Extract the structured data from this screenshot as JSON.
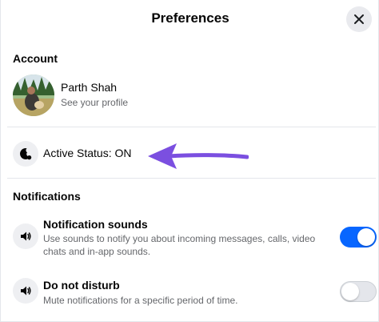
{
  "header": {
    "title": "Preferences"
  },
  "account": {
    "section_title": "Account",
    "profile_name": "Parth Shah",
    "profile_link": "See your profile"
  },
  "active_status": {
    "label": "Active Status: ON"
  },
  "notifications": {
    "section_title": "Notifications",
    "items": [
      {
        "title": "Notification sounds",
        "description": "Use sounds to notify you about incoming messages, calls, video chats and in-app sounds.",
        "enabled": true
      },
      {
        "title": "Do not disturb",
        "description": "Mute notifications for a specific period of time.",
        "enabled": false
      }
    ]
  },
  "colors": {
    "toggle_on": "#0866ff",
    "arrow": "#7b4fe0",
    "secondary_text": "#65676b"
  },
  "icons": [
    "close-icon",
    "active-status-icon",
    "speaker-icon",
    "speaker-icon"
  ]
}
